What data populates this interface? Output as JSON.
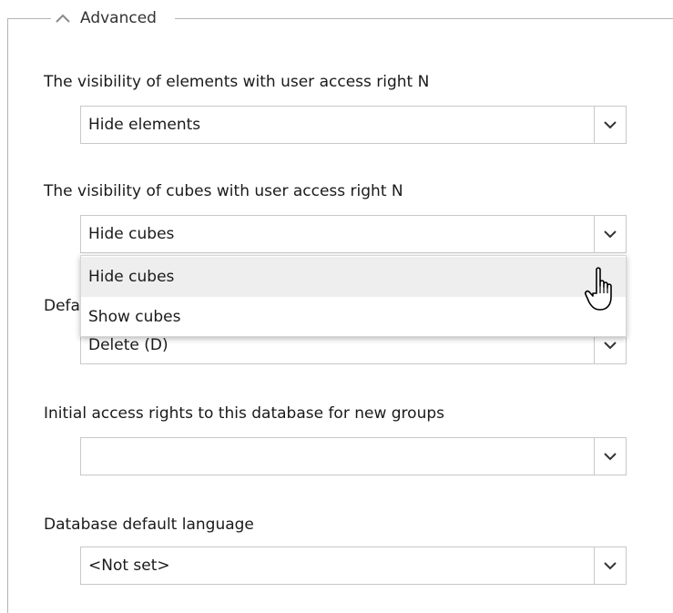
{
  "group": {
    "legend": "Advanced",
    "toggle_icon": "chevron-up-icon"
  },
  "fields": [
    {
      "label": "The visibility of elements with user access right N",
      "value": "Hide elements"
    },
    {
      "label": "The visibility of cubes with user access right N",
      "value": "Hide cubes"
    },
    {
      "label": "Default ",
      "label_visible": "Defa",
      "value": "Delete (D)"
    },
    {
      "label": "Initial access rights to this database for new groups",
      "value": ""
    },
    {
      "label": "Database default language",
      "value": "<Not set>"
    }
  ],
  "dropdown": {
    "options": [
      "Hide cubes",
      "Show cubes"
    ],
    "hovered_index": 0
  },
  "cursor": "hand-pointer-icon",
  "colors": {
    "border": "#c8c8c8",
    "frame": "#b4b4b4",
    "hover": "#eeeeee",
    "text": "#1a1a1a"
  }
}
